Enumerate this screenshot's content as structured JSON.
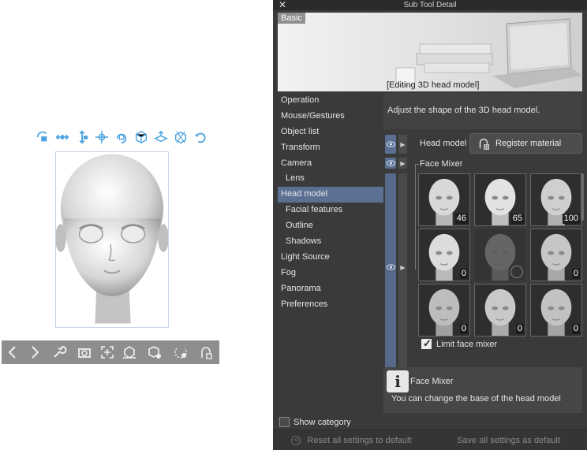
{
  "window": {
    "title": "Sub Tool Detail",
    "close_glyph": "✕"
  },
  "preview": {
    "tag": "Basic",
    "caption": "[Editing 3D head model]"
  },
  "categories": [
    {
      "label": "Operation",
      "sub": false
    },
    {
      "label": "Mouse/Gestures",
      "sub": false
    },
    {
      "label": "Object list",
      "sub": false
    },
    {
      "label": "Transform",
      "sub": false
    },
    {
      "label": "Camera",
      "sub": false
    },
    {
      "label": "Lens",
      "sub": true
    },
    {
      "label": "Head model",
      "sub": false,
      "selected": true
    },
    {
      "label": "Facial features",
      "sub": true
    },
    {
      "label": "Outline",
      "sub": true
    },
    {
      "label": "Shadows",
      "sub": true
    },
    {
      "label": "Light Source",
      "sub": false
    },
    {
      "label": "Fog",
      "sub": false
    },
    {
      "label": "Panorama",
      "sub": false
    },
    {
      "label": "Preferences",
      "sub": false
    }
  ],
  "description": "Adjust the shape of the 3D head model.",
  "head_model": {
    "label": "Head model",
    "register_button": "Register material",
    "register_icon": "register-material-icon"
  },
  "face_mixer": {
    "label": "Face Mixer",
    "values": [
      "46",
      "65",
      "100",
      "0",
      "",
      "0",
      "0",
      "0",
      "0"
    ],
    "limit_label": "Limit face mixer",
    "limit_checked": true
  },
  "info": {
    "icon": "i",
    "title": "Face Mixer",
    "text": "You can change the base of the head model"
  },
  "show_category": {
    "label": "Show category",
    "checked": false
  },
  "footer": {
    "reset_label": "Reset all settings to default",
    "save_label": "Save all settings as default"
  },
  "colors": {
    "accent": "#5c7094",
    "panel_bg": "#3a3a3a",
    "tool_icon": "#4aa3e0"
  }
}
